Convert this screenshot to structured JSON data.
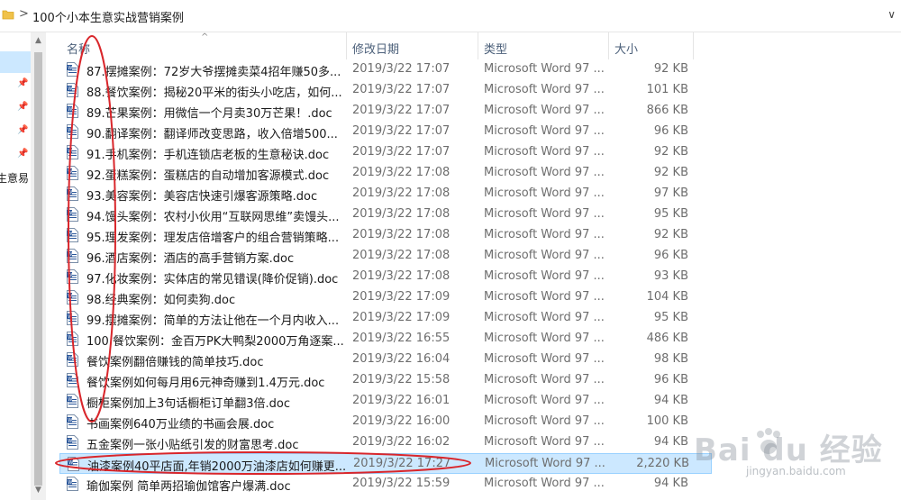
{
  "address_bar": {
    "path": "100个小本生意实战营销案例",
    "separator": ">",
    "folder_icon": "folder-icon"
  },
  "nav_pane": {
    "cut_label": "生意易",
    "pin_icon": "pin-icon"
  },
  "columns": {
    "name": "名称",
    "date": "修改日期",
    "type": "类型",
    "size": "大小"
  },
  "files": [
    {
      "name": "87.摆摊案例：72岁大爷摆摊卖菜4招年赚50多...",
      "date": "2019/3/22 17:07",
      "type": "Microsoft Word 97 ...",
      "size": "92 KB"
    },
    {
      "name": "88.餐饮案例：揭秘20平米的街头小吃店，如何...",
      "date": "2019/3/22 17:07",
      "type": "Microsoft Word 97 ...",
      "size": "101 KB"
    },
    {
      "name": "89.芒果案例：用微信一个月卖30万芒果！.doc",
      "date": "2019/3/22 17:07",
      "type": "Microsoft Word 97 ...",
      "size": "866 KB"
    },
    {
      "name": "90.翻译案例：翻译师改变思路，收入倍增500...",
      "date": "2019/3/22 17:07",
      "type": "Microsoft Word 97 ...",
      "size": "96 KB"
    },
    {
      "name": "91.手机案例：手机连锁店老板的生意秘诀.doc",
      "date": "2019/3/22 17:07",
      "type": "Microsoft Word 97 ...",
      "size": "92 KB"
    },
    {
      "name": "92.蛋糕案例：蛋糕店的自动增加客源模式.doc",
      "date": "2019/3/22 17:08",
      "type": "Microsoft Word 97 ...",
      "size": "92 KB"
    },
    {
      "name": "93.美容案例：美容店快速引爆客源策略.doc",
      "date": "2019/3/22 17:08",
      "type": "Microsoft Word 97 ...",
      "size": "97 KB"
    },
    {
      "name": "94.馒头案例：农村小伙用“互联网思维”卖馒头...",
      "date": "2019/3/22 17:08",
      "type": "Microsoft Word 97 ...",
      "size": "95 KB"
    },
    {
      "name": "95.理发案例：理发店倍增客户的组合营销策略...",
      "date": "2019/3/22 17:08",
      "type": "Microsoft Word 97 ...",
      "size": "92 KB"
    },
    {
      "name": "96.酒店案例：酒店的高手营销方案.doc",
      "date": "2019/3/22 17:08",
      "type": "Microsoft Word 97 ...",
      "size": "96 KB"
    },
    {
      "name": "97.化妆案例：实体店的常见错误(降价促销).doc",
      "date": "2019/3/22 17:08",
      "type": "Microsoft Word 97 ...",
      "size": "93 KB"
    },
    {
      "name": "98.经典案例：如何卖狗.doc",
      "date": "2019/3/22 17:09",
      "type": "Microsoft Word 97 ...",
      "size": "104 KB"
    },
    {
      "name": "99.摆摊案例：简单的方法让他在一个月内收入...",
      "date": "2019/3/22 17:09",
      "type": "Microsoft Word 97 ...",
      "size": "95 KB"
    },
    {
      "name": "100.餐饮案例：金百万PK大鸭梨2000万角逐案...",
      "date": "2019/3/22 16:55",
      "type": "Microsoft Word 97 ...",
      "size": "486 KB"
    },
    {
      "name": "餐饮案例翻倍赚钱的简单技巧.doc",
      "date": "2019/3/22 16:04",
      "type": "Microsoft Word 97 ...",
      "size": "98 KB"
    },
    {
      "name": "餐饮案例如何每月用6元神奇赚到1.4万元.doc",
      "date": "2019/3/22 15:58",
      "type": "Microsoft Word 97 ...",
      "size": "96 KB"
    },
    {
      "name": "橱柜案例加上3句话橱柜订单翻3倍.doc",
      "date": "2019/3/22 16:01",
      "type": "Microsoft Word 97 ...",
      "size": "94 KB"
    },
    {
      "name": "书画案例640万业绩的书画会展.doc",
      "date": "2019/3/22 16:00",
      "type": "Microsoft Word 97 ...",
      "size": "100 KB"
    },
    {
      "name": "五金案例一张小贴纸引发的财富思考.doc",
      "date": "2019/3/22 16:02",
      "type": "Microsoft Word 97 ...",
      "size": "94 KB"
    },
    {
      "name": "油漆案例40平店面,年销2000万油漆店如何赚更...",
      "date": "2019/3/22 17:27",
      "type": "Microsoft Word 97 ...",
      "size": "2,220 KB",
      "selected": true
    },
    {
      "name": "瑜伽案例 简单两招瑜伽馆客户爆满.doc",
      "date": "2019/3/22 15:59",
      "type": "Microsoft Word 97 ...",
      "size": "94 KB"
    }
  ],
  "file_icon": "word-document-icon",
  "watermark": {
    "logo": "Bai du 经验",
    "url": "jingyan.baidu.com"
  },
  "colors": {
    "selection": "#cce8ff",
    "annotation": "#d9262b"
  }
}
